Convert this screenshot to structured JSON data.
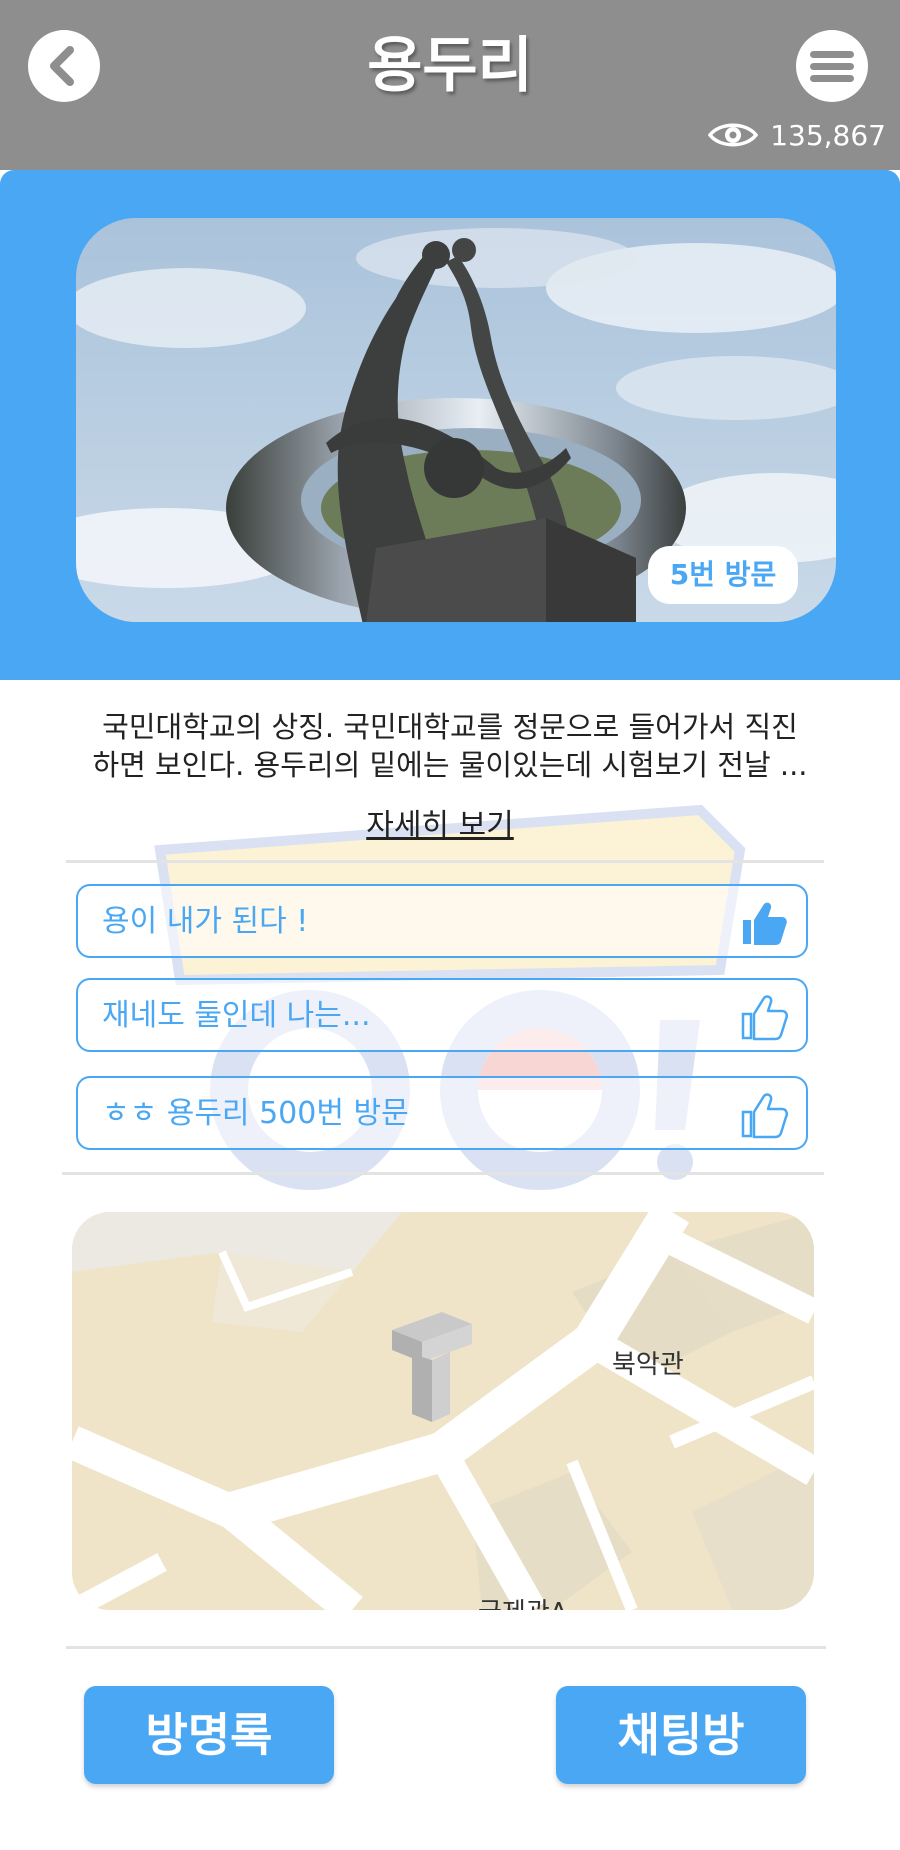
{
  "header": {
    "title": "용두리",
    "view_count": "135,867"
  },
  "hero": {
    "visit_badge": "5번 방문"
  },
  "description": {
    "line1": "국민대학교의 상징. 국민대학교를 정문으로 들어가서 직진",
    "line2": "하면 보인다. 용두리의 밑에는 물이있는데 시험보기 전날 ...",
    "more_label": "자세히 보기"
  },
  "comments": [
    {
      "text": "용이 내가 된다 !",
      "liked": true
    },
    {
      "text": "재네도 둘인데 나는...",
      "liked": false
    },
    {
      "text": "ㅎㅎ 용두리 500번 방문",
      "liked": false
    }
  ],
  "map": {
    "label_building_north": "북악관",
    "label_building_intl": "국제관A"
  },
  "buttons": {
    "guestbook": "방명록",
    "chatroom": "채팅방"
  },
  "colors": {
    "accent": "#4aa7f4",
    "header_bg": "#8e8e8e",
    "map_bg": "#efe4c8"
  }
}
